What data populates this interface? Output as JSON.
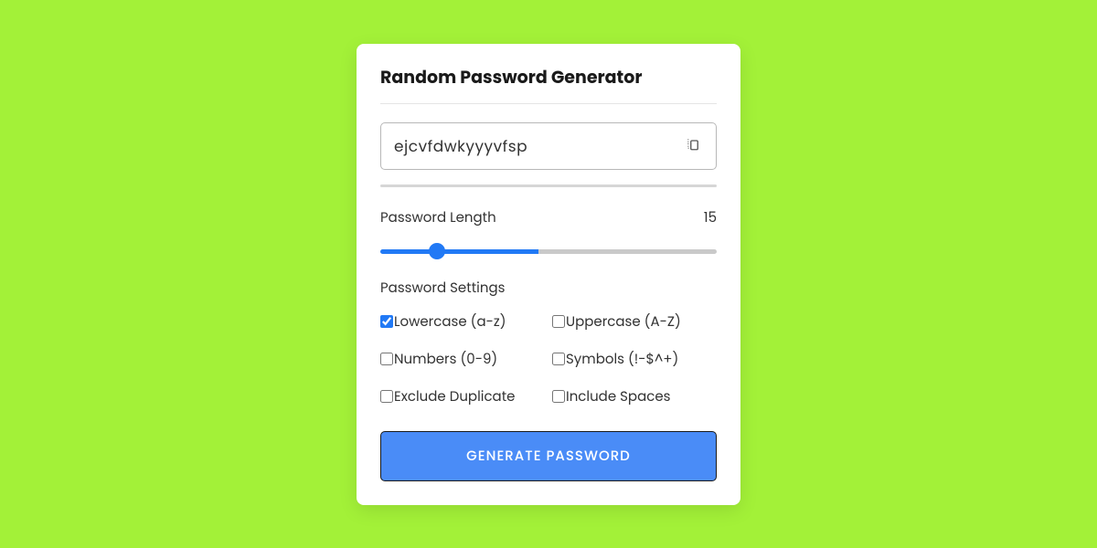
{
  "title": "Random Password Generator",
  "output": {
    "value": "ejcvfdwkyyyvfsp"
  },
  "length": {
    "label": "Password Length",
    "value": "15",
    "min": "1",
    "max": "30"
  },
  "settings": {
    "label": "Password Settings",
    "options": {
      "lowercase": "Lowercase (a-z)",
      "uppercase": "Uppercase (A-Z)",
      "numbers": "Numbers (0-9)",
      "symbols": "Symbols (!-$^+)",
      "exclude": "Exclude Duplicate",
      "spaces": "Include Spaces"
    }
  },
  "button": {
    "generate": "Generate Password"
  }
}
